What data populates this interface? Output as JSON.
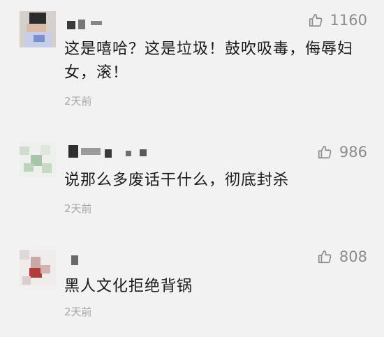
{
  "comments": [
    {
      "likes": "1160",
      "text": "这是嘻哈？这是垃圾！鼓吹吸毒，侮辱妇女，滚！",
      "time": "2天前"
    },
    {
      "likes": "986",
      "text": "说那么多废话干什么，彻底封杀",
      "time": "2天前"
    },
    {
      "likes": "808",
      "text": "黑人文化拒绝背锅",
      "time": "2天前"
    }
  ],
  "icons": {
    "like": "thumbs-up-icon"
  }
}
